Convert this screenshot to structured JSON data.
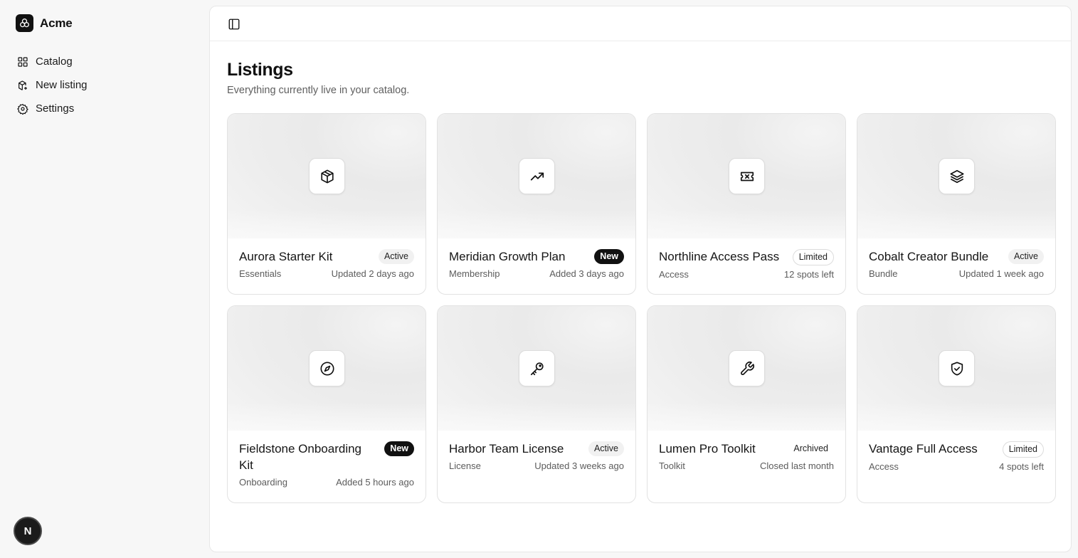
{
  "app": {
    "name": "Acme"
  },
  "sidebar": {
    "items": [
      {
        "label": "Catalog",
        "icon": "grid-icon"
      },
      {
        "label": "New listing",
        "icon": "package-plus-icon"
      },
      {
        "label": "Settings",
        "icon": "gear-icon"
      }
    ],
    "avatar_initial": "N"
  },
  "page": {
    "title": "Listings",
    "subtitle": "Everything currently live in your catalog."
  },
  "listings": [
    {
      "title": "Aurora Starter Kit",
      "badge": "Active",
      "badge_style": "soft",
      "category": "Essentials",
      "status": "Updated 2 days ago",
      "icon": "box-icon"
    },
    {
      "title": "Meridian Growth Plan",
      "badge": "New",
      "badge_style": "dark",
      "category": "Membership",
      "status": "Added 3 days ago",
      "icon": "trending-up-icon"
    },
    {
      "title": "Northline Access Pass",
      "badge": "Limited",
      "badge_style": "outline",
      "category": "Access",
      "status": "12 spots left",
      "icon": "ticket-icon"
    },
    {
      "title": "Cobalt Creator Bundle",
      "badge": "Active",
      "badge_style": "soft",
      "category": "Bundle",
      "status": "Updated 1 week ago",
      "icon": "layers-icon"
    },
    {
      "title": "Fieldstone Onboarding Kit",
      "badge": "New",
      "badge_style": "dark",
      "category": "Onboarding",
      "status": "Added 5 hours ago",
      "icon": "compass-icon"
    },
    {
      "title": "Harbor Team License",
      "badge": "Active",
      "badge_style": "soft",
      "category": "License",
      "status": "Updated 3 weeks ago",
      "icon": "key-icon"
    },
    {
      "title": "Lumen Pro Toolkit",
      "badge": "Archived",
      "badge_style": "plain",
      "category": "Toolkit",
      "status": "Closed last month",
      "icon": "wrench-icon"
    },
    {
      "title": "Vantage Full Access",
      "badge": "Limited",
      "badge_style": "outline",
      "category": "Access",
      "status": "4 spots left",
      "icon": "shield-check-icon"
    }
  ]
}
